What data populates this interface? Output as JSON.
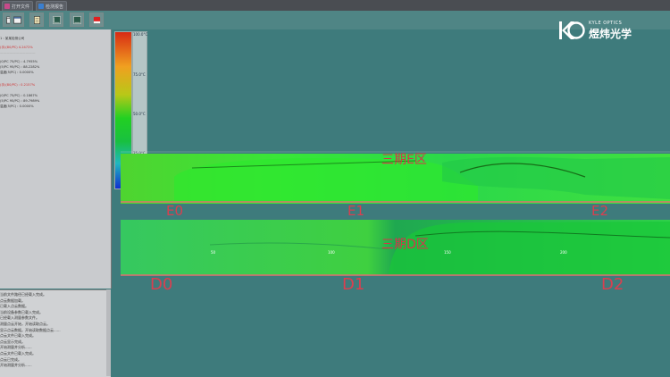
{
  "titlebar": {
    "tabs": [
      {
        "label": "打开文件",
        "color": "#c84a8a"
      },
      {
        "label": "检测报告",
        "color": "#3a7fd0"
      }
    ]
  },
  "toolbar": {
    "buttons": [
      {
        "name": "open-file-button",
        "icon": "folder-icon"
      },
      {
        "name": "window-button",
        "icon": "window-icon"
      },
      {
        "name": "report-button",
        "icon": "document-icon"
      },
      {
        "name": "chart-button",
        "icon": "chart-icon"
      },
      {
        "name": "view-button",
        "icon": "monitor-icon"
      },
      {
        "name": "record-button",
        "icon": "record-icon"
      }
    ]
  },
  "brand": {
    "en": "KYLE OPTICS",
    "cn": "煜炜光学"
  },
  "left_panel": {
    "lines": [
      {
        "text": "1 : 某某检测公司",
        "color": "#333333"
      },
      {
        "text": "(手)(80/PC) 4.2472%",
        "color": "#d03030"
      },
      {
        "text": "———————————",
        "color": "#999999"
      },
      {
        "text": "(0/PC 75/PC) : 4.7955%",
        "color": "#333333"
      },
      {
        "text": "(5/PC 95/PC) : 88.2282%",
        "color": "#333333"
      },
      {
        "text": "温度(5/PC) : 0.0000%",
        "color": "#333333"
      },
      {
        "text": "(手)(80/PC) : 0.2157%",
        "color": "#d03030"
      },
      {
        "text": "(0/PC 75/PC) : 0.1867%",
        "color": "#333333"
      },
      {
        "text": "(5/PC 95/PC) : 89.7989%",
        "color": "#333333"
      },
      {
        "text": "温度(5/PC) : 0.0000%",
        "color": "#333333"
      }
    ]
  },
  "log_panel": {
    "lines": [
      "当前文件路径已经载入完成。",
      "点云数据加载。",
      "已载入点云数据。",
      "当前设备参数已载入完成。",
      "已经载入测量参数文件。",
      "测量点云开始，开始读取点云。",
      "显示点云数据。开始读取数据点云......",
      "点云文件已载入完成。",
      "点云显示完成。",
      "开始测量并分析......",
      "点云文件已载入完成。",
      "点云已完成。",
      "开始测量并分析......"
    ]
  },
  "colorbar": {
    "ticks": [
      "100.0°C",
      "75.0°C",
      "50.0°C",
      "25.0°C"
    ]
  },
  "strips": [
    {
      "region_label": "三期E区",
      "marks": [
        "E0",
        "E1",
        "E2"
      ],
      "axis_ticks": []
    },
    {
      "region_label": "三期D区",
      "marks": [
        "D0",
        "D1",
        "D2"
      ],
      "axis_ticks": [
        "50",
        "100",
        "150",
        "200"
      ]
    }
  ]
}
